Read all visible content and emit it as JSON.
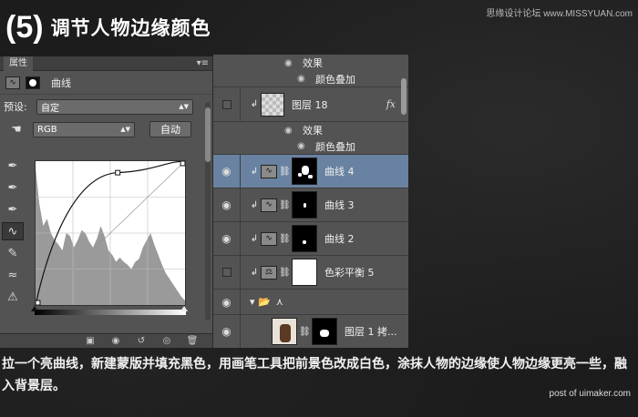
{
  "title": {
    "step": "(5)",
    "text": "调节人物边缘颜色"
  },
  "watermark_top": "思缘设计论坛 www.MISSYUAN.com",
  "watermark_bottom": "post of uimaker.com",
  "properties_panel": {
    "tab": "属性",
    "menu_icon": "panel-menu-icon",
    "header_label": "曲线",
    "preset_label": "预设:",
    "preset_value": "自定",
    "channel_value": "RGB",
    "auto_button": "自动",
    "curve": {
      "points": [
        [
          0,
          0
        ],
        [
          0.55,
          0.92
        ],
        [
          1,
          1
        ]
      ],
      "histogram": [
        0.95,
        0.7,
        0.55,
        0.6,
        0.5,
        0.45,
        0.42,
        0.38,
        0.5,
        0.48,
        0.4,
        0.45,
        0.52,
        0.5,
        0.44,
        0.4,
        0.46,
        0.55,
        0.48,
        0.38,
        0.35,
        0.3,
        0.33,
        0.3,
        0.28,
        0.25,
        0.3,
        0.32,
        0.4,
        0.45,
        0.5,
        0.42,
        0.35,
        0.28,
        0.22,
        0.18,
        0.14,
        0.1,
        0.06,
        0.03
      ]
    }
  },
  "layers_panel": {
    "top_effects": [
      {
        "label": "效果"
      },
      {
        "label": "颜色叠加"
      }
    ],
    "layers": [
      {
        "name": "图层 18",
        "visible": false,
        "type": "pixel",
        "fx": "fx",
        "thumb": "checker"
      },
      {
        "name": "曲线 4",
        "visible": true,
        "type": "curves",
        "selected": true,
        "thumb": "mask"
      },
      {
        "name": "曲线 3",
        "visible": true,
        "type": "curves",
        "thumb": "mask"
      },
      {
        "name": "曲线 2",
        "visible": true,
        "type": "curves",
        "thumb": "mask"
      },
      {
        "name": "色彩平衡 5",
        "visible": false,
        "type": "color-balance",
        "thumb": "white"
      },
      {
        "name": "图层 1 拷...",
        "visible": true,
        "type": "pixel",
        "thumb": "photo"
      }
    ],
    "layer18_effects": [
      {
        "label": "效果"
      },
      {
        "label": "颜色叠加"
      }
    ]
  },
  "caption": "拉一个亮曲线，新建蒙版并填充黑色，用画笔工具把前景色改成白色，涂抹人物的边缘使人物边缘更亮一些，融入背景层。"
}
